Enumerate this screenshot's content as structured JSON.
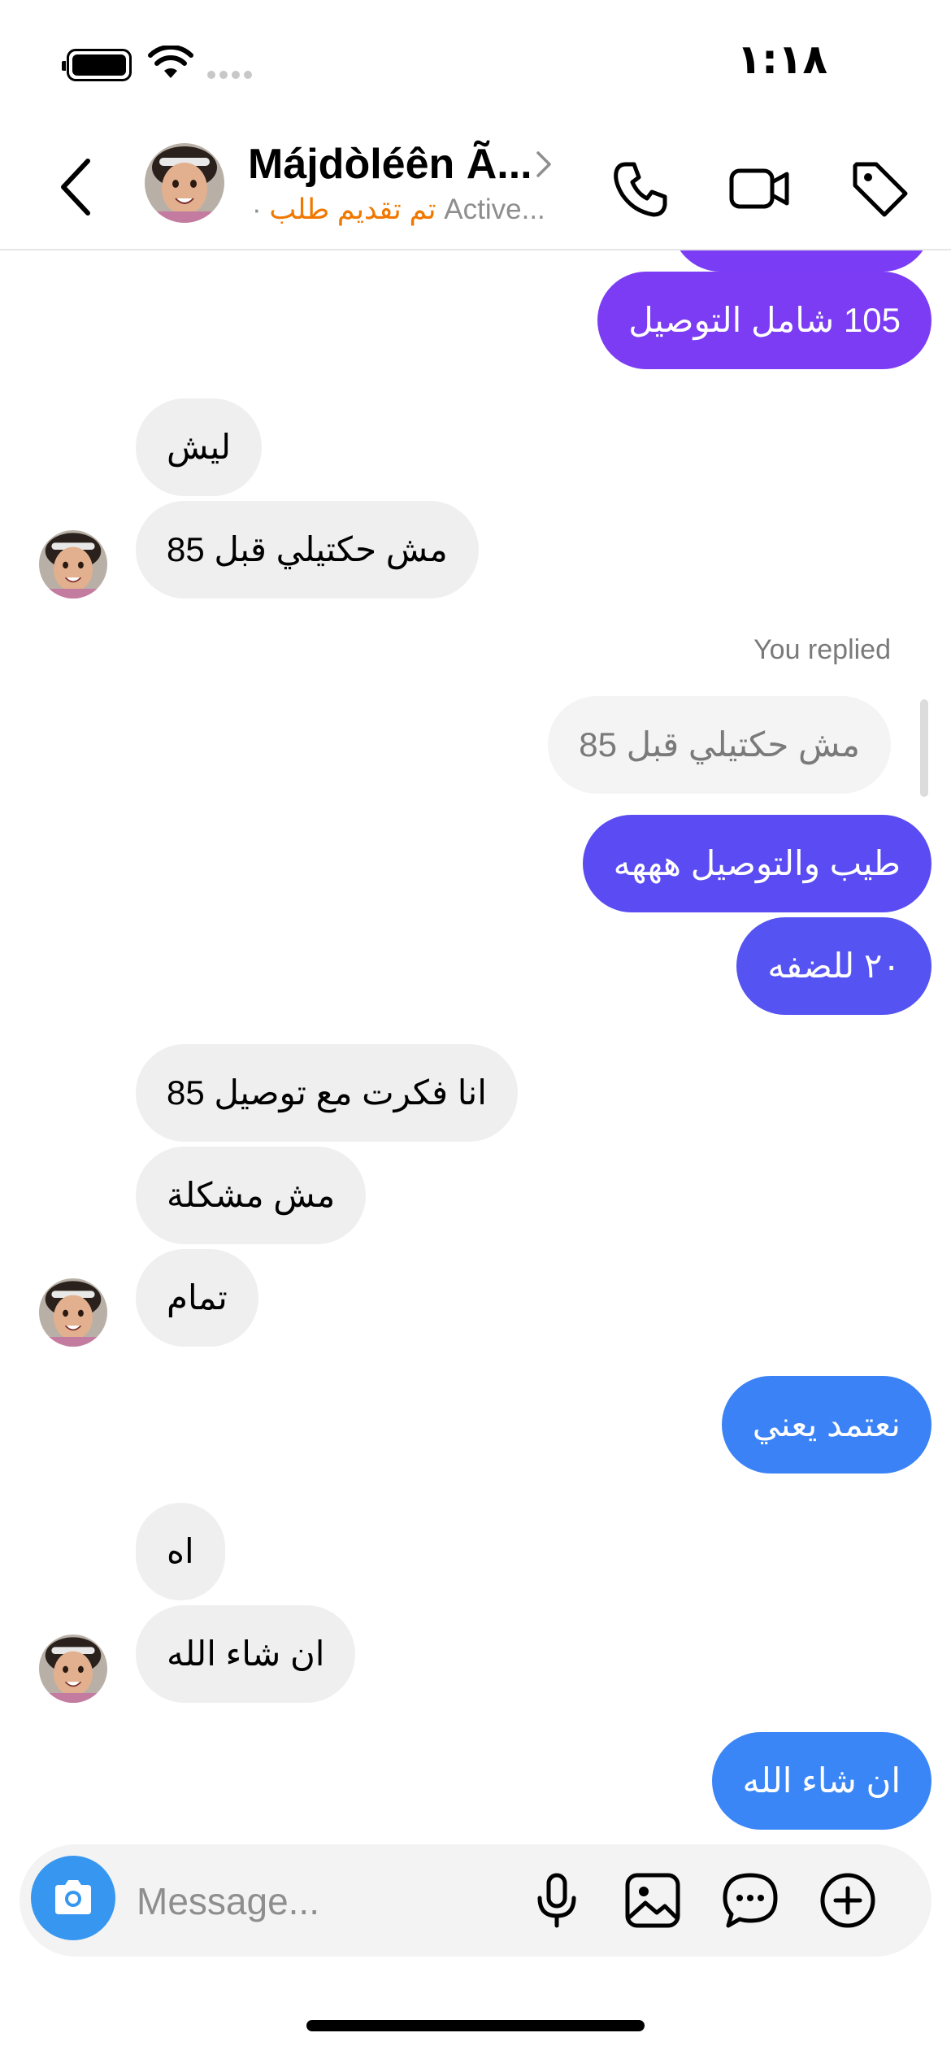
{
  "status_bar": {
    "time": "١:١٨"
  },
  "header": {
    "contact_name": "Májdòléên Ã...",
    "status_dot": "·",
    "request_status": "تم تقديم طلب",
    "active_status": "Active..."
  },
  "messages": [
    {
      "direction": "outgoing",
      "text": "",
      "color": "#7a3cf5"
    },
    {
      "direction": "outgoing",
      "text": "105 شامل التوصيل",
      "color": "#7b3cf4"
    },
    {
      "direction": "incoming",
      "text": "ليش"
    },
    {
      "direction": "incoming",
      "text": "مش حكتيلي قبل 85"
    },
    {
      "direction": "outgoing",
      "text": "طيب والتوصيل هههه",
      "color": "#5a4cf2"
    },
    {
      "direction": "outgoing",
      "text": "٢٠ للضفه",
      "color": "#5553f1"
    },
    {
      "direction": "incoming",
      "text": "انا فكرت مع توصيل 85"
    },
    {
      "direction": "incoming",
      "text": "مش مشكلة"
    },
    {
      "direction": "incoming",
      "text": "تمام"
    },
    {
      "direction": "outgoing",
      "text": "نعتمد يعني",
      "color": "#3a82f6"
    },
    {
      "direction": "incoming",
      "text": "اه"
    },
    {
      "direction": "incoming",
      "text": "ان شاء الله"
    },
    {
      "direction": "outgoing",
      "text": "ان شاء الله",
      "color": "#3b86f7"
    }
  ],
  "reply": {
    "label": "You replied",
    "quoted_text": "مش حكتيلي قبل 85"
  },
  "composer": {
    "placeholder": "Message...",
    "value": ""
  },
  "colors": {
    "request_status": "#f07800",
    "camera_button": "#3797f0",
    "incoming_bubble": "#efefef"
  },
  "icons": {
    "header": [
      "back-arrow-icon",
      "phone-icon",
      "video-camera-icon",
      "tag-icon"
    ],
    "composer": [
      "camera-icon",
      "microphone-icon",
      "image-icon",
      "sticker-chat-icon",
      "add-circle-icon"
    ]
  }
}
